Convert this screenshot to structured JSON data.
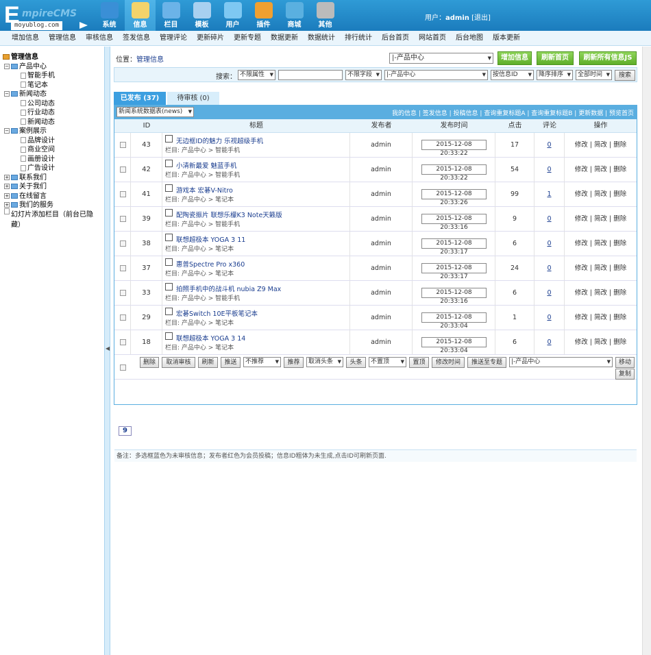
{
  "logo": {
    "big": "E",
    "rest": "mpireCMS",
    "watermark": "moyublog.com"
  },
  "topnav": [
    {
      "label": "系统",
      "icon": "globe-icon",
      "color": "#3a8fd6"
    },
    {
      "label": "信息",
      "icon": "notepad-icon",
      "color": "#f3d36b",
      "active": true
    },
    {
      "label": "栏目",
      "icon": "folder-icon",
      "color": "#6bb3e8"
    },
    {
      "label": "模板",
      "icon": "template-icon",
      "color": "#a8d0f0"
    },
    {
      "label": "用户",
      "icon": "user-icon",
      "color": "#7ec8f2"
    },
    {
      "label": "插件",
      "icon": "tools-icon",
      "color": "#f0a030"
    },
    {
      "label": "商城",
      "icon": "shop-icon",
      "color": "#5ab0e0"
    },
    {
      "label": "其他",
      "icon": "gear-icon",
      "color": "#bbbbbb"
    }
  ],
  "user": {
    "prefix": "用户：",
    "name": "admin",
    "logout": "[退出]"
  },
  "submenu": [
    "增加信息",
    "管理信息",
    "审核信息",
    "签发信息",
    "管理评论",
    "更新碎片",
    "更新专题",
    "数据更新",
    "数据统计",
    "排行统计",
    "后台首页",
    "网站首页",
    "后台地图",
    "版本更新"
  ],
  "tree": [
    {
      "label": "管理信息",
      "level": 0,
      "type": "root"
    },
    {
      "label": "产品中心",
      "level": 1,
      "type": "folder"
    },
    {
      "label": "智能手机",
      "level": 2,
      "type": "page"
    },
    {
      "label": "笔记本",
      "level": 2,
      "type": "page"
    },
    {
      "label": "新闻动态",
      "level": 1,
      "type": "folder"
    },
    {
      "label": "公司动态",
      "level": 2,
      "type": "page"
    },
    {
      "label": "行业动态",
      "level": 2,
      "type": "page"
    },
    {
      "label": "新闻动态",
      "level": 2,
      "type": "page"
    },
    {
      "label": "案例展示",
      "level": 1,
      "type": "folder"
    },
    {
      "label": "品牌设计",
      "level": 2,
      "type": "page"
    },
    {
      "label": "商业空间",
      "level": 2,
      "type": "page"
    },
    {
      "label": "画册设计",
      "level": 2,
      "type": "page"
    },
    {
      "label": "广告设计",
      "level": 2,
      "type": "page"
    },
    {
      "label": "联系我们",
      "level": 1,
      "type": "folder"
    },
    {
      "label": "关于我们",
      "level": 1,
      "type": "folder"
    },
    {
      "label": "在线留言",
      "level": 1,
      "type": "folder"
    },
    {
      "label": "我们的服务",
      "level": 1,
      "type": "folder"
    },
    {
      "label": "幻灯片添加栏目（前台已隐藏）",
      "level": 1,
      "type": "page"
    }
  ],
  "position": {
    "label": "位置：",
    "link": "管理信息"
  },
  "column_select": "|-产品中心",
  "actions": {
    "add": "增加信息",
    "refresh": "刷新首页",
    "refresh_js": "刷新所有信息JS"
  },
  "search": {
    "label": "搜索：",
    "attr": "不限属性",
    "field": "不限字段",
    "column": "|-产品中心",
    "order_by": "按信息ID",
    "order": "降序排序",
    "time": "全部时间",
    "button": "搜索"
  },
  "tabs": {
    "published": "已发布 (37)",
    "pending": "待审核 (0)"
  },
  "table_select": "新闻系统数据表(news)",
  "panel_links": [
    "我的信息",
    "签发信息",
    "投稿信息",
    "查询重复标题A",
    "查询重复标题B",
    "更新数据",
    "预览首页"
  ],
  "columns": [
    "ID",
    "标题",
    "发布者",
    "发布时间",
    "点击",
    "评论",
    "操作"
  ],
  "rows": [
    {
      "id": "43",
      "title": "无边框ID的魅力 乐视超级手机",
      "cat_prefix": "栏目:",
      "cat": "产品中心 > 智能手机",
      "publisher": "admin",
      "time": "2015-12-08 20:33:22",
      "clicks": "17",
      "comments": "0",
      "ops": "修改 | 简改 | 删除"
    },
    {
      "id": "42",
      "title": "小清新最爱 魅蓝手机",
      "cat_prefix": "栏目:",
      "cat": "产品中心 > 智能手机",
      "publisher": "admin",
      "time": "2015-12-08 20:33:22",
      "clicks": "54",
      "comments": "0",
      "ops": "修改 | 简改 | 删除"
    },
    {
      "id": "41",
      "title": "游戏本 宏碁V-Nitro",
      "cat_prefix": "栏目:",
      "cat": "产品中心 > 笔记本",
      "publisher": "admin",
      "time": "2015-12-08 20:33:26",
      "clicks": "99",
      "comments": "1",
      "ops": "修改 | 简改 | 删除"
    },
    {
      "id": "39",
      "title": "配陶瓷振片 联想乐檬K3 Note天籁版",
      "cat_prefix": "栏目:",
      "cat": "产品中心 > 智能手机",
      "publisher": "admin",
      "time": "2015-12-08 20:33:16",
      "clicks": "9",
      "comments": "0",
      "ops": "修改 | 简改 | 删除"
    },
    {
      "id": "38",
      "title": "联想超极本 YOGA 3 11",
      "cat_prefix": "栏目:",
      "cat": "产品中心 > 笔记本",
      "publisher": "admin",
      "time": "2015-12-08 20:33:17",
      "clicks": "6",
      "comments": "0",
      "ops": "修改 | 简改 | 删除"
    },
    {
      "id": "37",
      "title": "惠普Spectre Pro x360",
      "cat_prefix": "栏目:",
      "cat": "产品中心 > 笔记本",
      "publisher": "admin",
      "time": "2015-12-08 20:33:17",
      "clicks": "24",
      "comments": "0",
      "ops": "修改 | 简改 | 删除"
    },
    {
      "id": "33",
      "title": "拍照手机中的战斗机 nubia Z9 Max",
      "cat_prefix": "栏目:",
      "cat": "产品中心 > 智能手机",
      "publisher": "admin",
      "time": "2015-12-08 20:33:16",
      "clicks": "6",
      "comments": "0",
      "ops": "修改 | 简改 | 删除"
    },
    {
      "id": "29",
      "title": "宏碁Switch 10E平板笔记本",
      "cat_prefix": "栏目:",
      "cat": "产品中心 > 笔记本",
      "publisher": "admin",
      "time": "2015-12-08 20:33:04",
      "clicks": "1",
      "comments": "0",
      "ops": "修改 | 简改 | 删除"
    },
    {
      "id": "18",
      "title": "联想超极本 YOGA 3 14",
      "cat_prefix": "栏目:",
      "cat": "产品中心 > 笔记本",
      "publisher": "admin",
      "time": "2015-12-08 20:33:04",
      "clicks": "6",
      "comments": "0",
      "ops": "修改 | 简改 | 删除"
    }
  ],
  "bulk": {
    "delete": "删除",
    "unaudit": "取消审核",
    "refresh": "刷新",
    "push": "推送",
    "recommend_sel": "不推荐",
    "recommend": "推荐",
    "headline_cancel_sel": "取消头条",
    "headline": "头条",
    "top_sel": "不置顶",
    "top": "置顶",
    "modtime": "修改时间",
    "push_topic": "推送至专题",
    "column": "|-产品中心",
    "move": "移动",
    "copy": "复制"
  },
  "pager": "9",
  "note": "备注：多选框蓝色为未审核信息；发布者红色为会员投稿；信息ID粗体为未生成,点击ID可刷新页面."
}
